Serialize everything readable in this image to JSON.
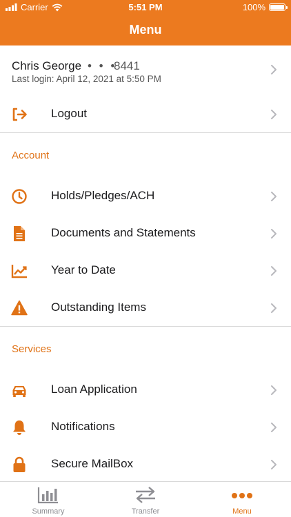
{
  "status_bar": {
    "carrier": "Carrier",
    "time": "5:51 PM",
    "battery": "100%"
  },
  "header": {
    "title": "Menu"
  },
  "profile": {
    "name": "Chris George",
    "masked": "• • •",
    "account_suffix": "8441",
    "last_login": "Last login: April 12, 2021 at 5:50 PM"
  },
  "logout": {
    "label": "Logout",
    "icon": "logout-icon"
  },
  "sections": {
    "account": {
      "heading": "Account",
      "items": [
        {
          "label": "Holds/Pledges/ACH",
          "icon": "clock-icon"
        },
        {
          "label": "Documents and Statements",
          "icon": "document-icon"
        },
        {
          "label": "Year to Date",
          "icon": "chart-trend-icon"
        },
        {
          "label": "Outstanding Items",
          "icon": "warning-icon"
        }
      ]
    },
    "services": {
      "heading": "Services",
      "items": [
        {
          "label": "Loan Application",
          "icon": "car-icon"
        },
        {
          "label": "Notifications",
          "icon": "bell-icon"
        },
        {
          "label": "Secure MailBox",
          "icon": "lock-icon"
        }
      ]
    }
  },
  "tabbar": {
    "tabs": [
      {
        "label": "Summary",
        "icon": "bar-chart-icon",
        "active": false
      },
      {
        "label": "Transfer",
        "icon": "transfer-arrows-icon",
        "active": false
      },
      {
        "label": "Menu",
        "icon": "more-dots-icon",
        "active": true
      }
    ]
  },
  "colors": {
    "accent": "#ec7a1f",
    "accent_text": "#e07216",
    "divider": "#d9d9d9"
  }
}
